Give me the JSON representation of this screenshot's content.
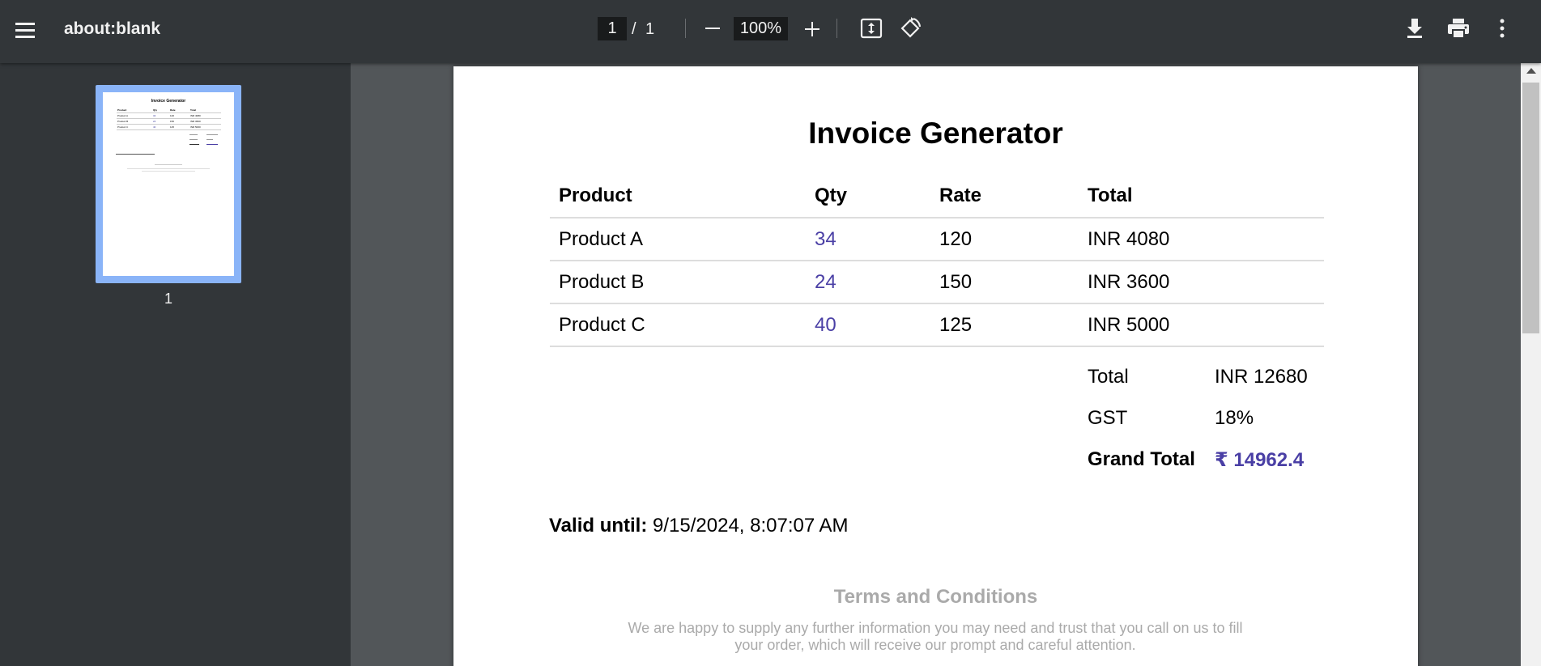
{
  "toolbar": {
    "title": "about:blank",
    "current_page": "1",
    "page_separator": "/",
    "total_pages": "1",
    "zoom": "100%"
  },
  "sidebar": {
    "thumbnail_label": "1"
  },
  "invoice": {
    "title": "Invoice Generator",
    "columns": [
      "Product",
      "Qty",
      "Rate",
      "Total"
    ],
    "rows": [
      {
        "product": "Product A",
        "qty": "34",
        "rate": "120",
        "total": "INR 4080"
      },
      {
        "product": "Product B",
        "qty": "24",
        "rate": "150",
        "total": "INR 3600"
      },
      {
        "product": "Product C",
        "qty": "40",
        "rate": "125",
        "total": "INR 5000"
      }
    ],
    "summary": {
      "total_label": "Total",
      "total_value": "INR 12680",
      "gst_label": "GST",
      "gst_value": "18%",
      "grand_label": "Grand Total",
      "grand_value": "₹ 14962.4"
    },
    "valid_label": "Valid until:",
    "valid_value": "9/15/2024, 8:07:07 AM",
    "terms_title": "Terms and Conditions",
    "terms_text": "We are happy to supply any further information you may need and trust that you call on us to fill your order, which will receive our prompt and careful attention."
  },
  "colors": {
    "toolbar_bg": "#323639",
    "viewer_bg": "#525659",
    "accent": "#4a3fa5",
    "thumb_highlight": "#8ab4f8"
  },
  "icons": [
    "menu-icon",
    "zoom-out-icon",
    "zoom-in-icon",
    "fit-page-icon",
    "rotate-icon",
    "download-icon",
    "print-icon",
    "more-vert-icon"
  ]
}
